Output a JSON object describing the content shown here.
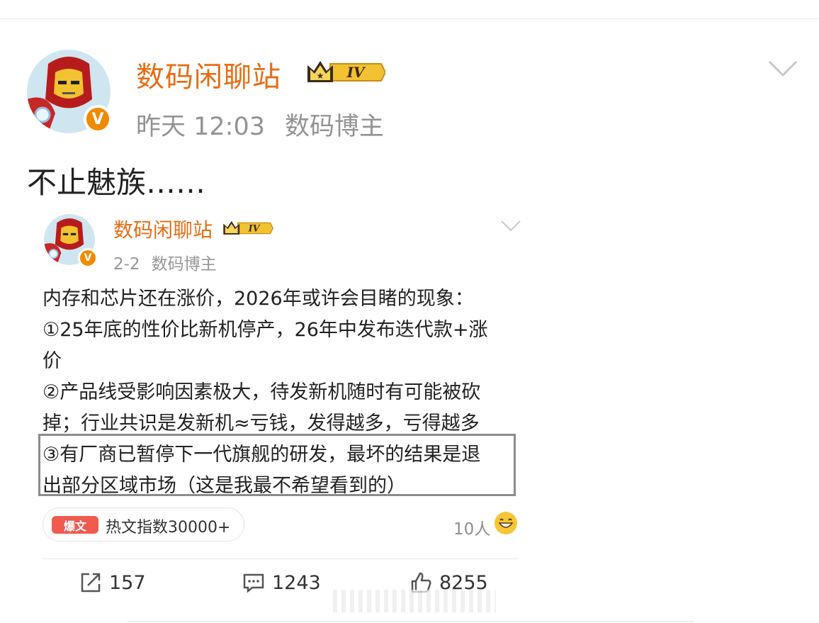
{
  "post": {
    "author": "数码闲聊站",
    "level": "IV",
    "time": "昨天 12:03",
    "source": "数码博主",
    "text": "不止魅族……"
  },
  "repost": {
    "author": "数码闲聊站",
    "level": "IV",
    "time": "2-2",
    "source": "数码博主",
    "lines": [
      "内存和芯片还在涨价，2026年或许会目睹的现象：",
      "①25年底的性价比新机停产，26年中发布迭代款+涨",
      "价",
      "②产品线受影响因素极大，待发新机随时有可能被砍",
      "掉；行业共识是发新机≈亏钱，发得越多，亏得越多",
      "③有厂商已暂停下一代旗舰的研发，最坏的结果是退",
      "出部分区域市场（这是我最不希望看到的）"
    ],
    "hot_badge": "爆文",
    "hot_text": "热文指数30000+",
    "reactions_count": "10人"
  },
  "actions": {
    "repost": "157",
    "comment": "1243",
    "like": "8255"
  },
  "colors": {
    "author": "#e86c12",
    "meta": "#939393",
    "verified": "#f08a00",
    "hot_badge": "#f05a4f"
  },
  "icons": [
    "avatar-ironman",
    "verified-v-icon",
    "crown-level-icon",
    "chevron-down-icon",
    "repost-icon",
    "comment-icon",
    "like-icon",
    "grin-emoji-icon"
  ]
}
